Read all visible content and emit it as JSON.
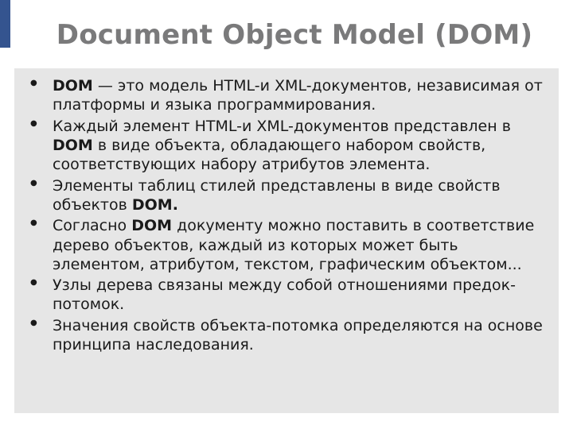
{
  "title": "Document Object Model (DOM)",
  "bullets": [
    {
      "segments": [
        {
          "text": "DOM",
          "bold": true
        },
        {
          "text": " — это модель HTML-и XML-документов, независимая от платформы и языка программирования.",
          "bold": false
        }
      ]
    },
    {
      "segments": [
        {
          "text": "Каждый элемент HTML-и XML-документов представлен в ",
          "bold": false
        },
        {
          "text": "DOM",
          "bold": true
        },
        {
          "text": " в виде объекта, обладающего набором свойств, соответствующих набору атрибутов элемента.",
          "bold": false
        }
      ]
    },
    {
      "segments": [
        {
          "text": "Элементы таблиц стилей представлены в виде свойств объектов ",
          "bold": false
        },
        {
          "text": "DOM.",
          "bold": true
        }
      ]
    },
    {
      "segments": [
        {
          "text": "Согласно ",
          "bold": false
        },
        {
          "text": "DOM",
          "bold": true
        },
        {
          "text": " документу можно поставить в соответствие дерево объектов, каждый из которых может быть элементом, атрибутом, текстом, графическим объектом...",
          "bold": false
        }
      ]
    },
    {
      "segments": [
        {
          "text": "Узлы дерева связаны между собой отношениями предок-потомок.",
          "bold": false
        }
      ]
    },
    {
      "segments": [
        {
          "text": "Значения свойств объекта-потомка определяются на основе принципа наследования.",
          "bold": false
        }
      ]
    }
  ]
}
